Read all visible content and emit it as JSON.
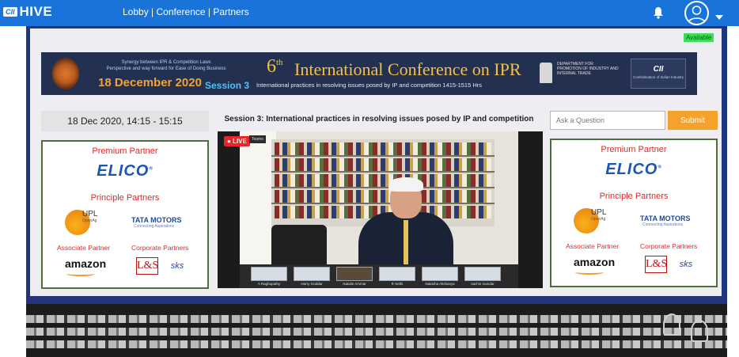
{
  "app": {
    "brand_badge": "CII",
    "brand_name": "HIVE"
  },
  "nav": {
    "lobby": "Lobby",
    "sep1": " | ",
    "conference": "Conference",
    "sep2": " | ",
    "partners": "Partners"
  },
  "icons": {
    "bell": "bell-icon",
    "user": "user-avatar-icon",
    "caret": "caret-down-icon",
    "fingerprint": "fingerprint-logo-icon",
    "emblem": "india-emblem-icon"
  },
  "status": {
    "availability": "Available"
  },
  "banner": {
    "synergy_line1": "Synergy between IPR & Competition Laws",
    "synergy_line2": "Perspective and way forward for Ease of Doing Business",
    "date": "18 December 2020",
    "ordinal_num": "6",
    "ordinal_suffix": "th",
    "title": "International Conference on IPR",
    "session": "Session 3",
    "session_desc": "International practices in resolving issues posed by IP and competition 1415-1515 Hrs",
    "dept_lines": [
      "DEPARTMENT FOR",
      "PROMOTION OF INDUSTRY AND",
      "INTERNAL TRADE"
    ],
    "cii_name": "CII",
    "cii_sub": "Confederation of Indian Industry"
  },
  "session_time": "18 Dec 2020, 14:15 - 15:15",
  "session_heading": "Session 3: International practices in resolving issues posed by IP and competition",
  "video": {
    "live_label": "LIVE",
    "teams_tag": "Teams",
    "participants": [
      "A Raghupathy",
      "Harry Goddar",
      "Natalie Ammar",
      "R Sethi",
      "Natasha Akshavya",
      "sachin mandar"
    ]
  },
  "question": {
    "placeholder": "Ask a Question",
    "submit_label": "Submit"
  },
  "partners": {
    "premium_heading": "Premium Partner",
    "premium_name": "ELICO",
    "principle_heading": "Principle Partners",
    "upl_name": "UPL",
    "upl_tagline": "OpenAg",
    "tata_name": "TATA MOTORS",
    "tata_tagline": "Connecting Aspirations",
    "associate_heading": "Associate Partner",
    "associate_name": "amazon",
    "corporate_heading": "Corporate Partners",
    "corporate_1": "L&S",
    "corporate_2": "sks"
  },
  "colors": {
    "nav_blue": "#1a73d8",
    "stage_blue": "#1e3580",
    "accent_red": "#e0282a",
    "submit_orange": "#f5a22c",
    "available_green": "#3ddc5a"
  }
}
